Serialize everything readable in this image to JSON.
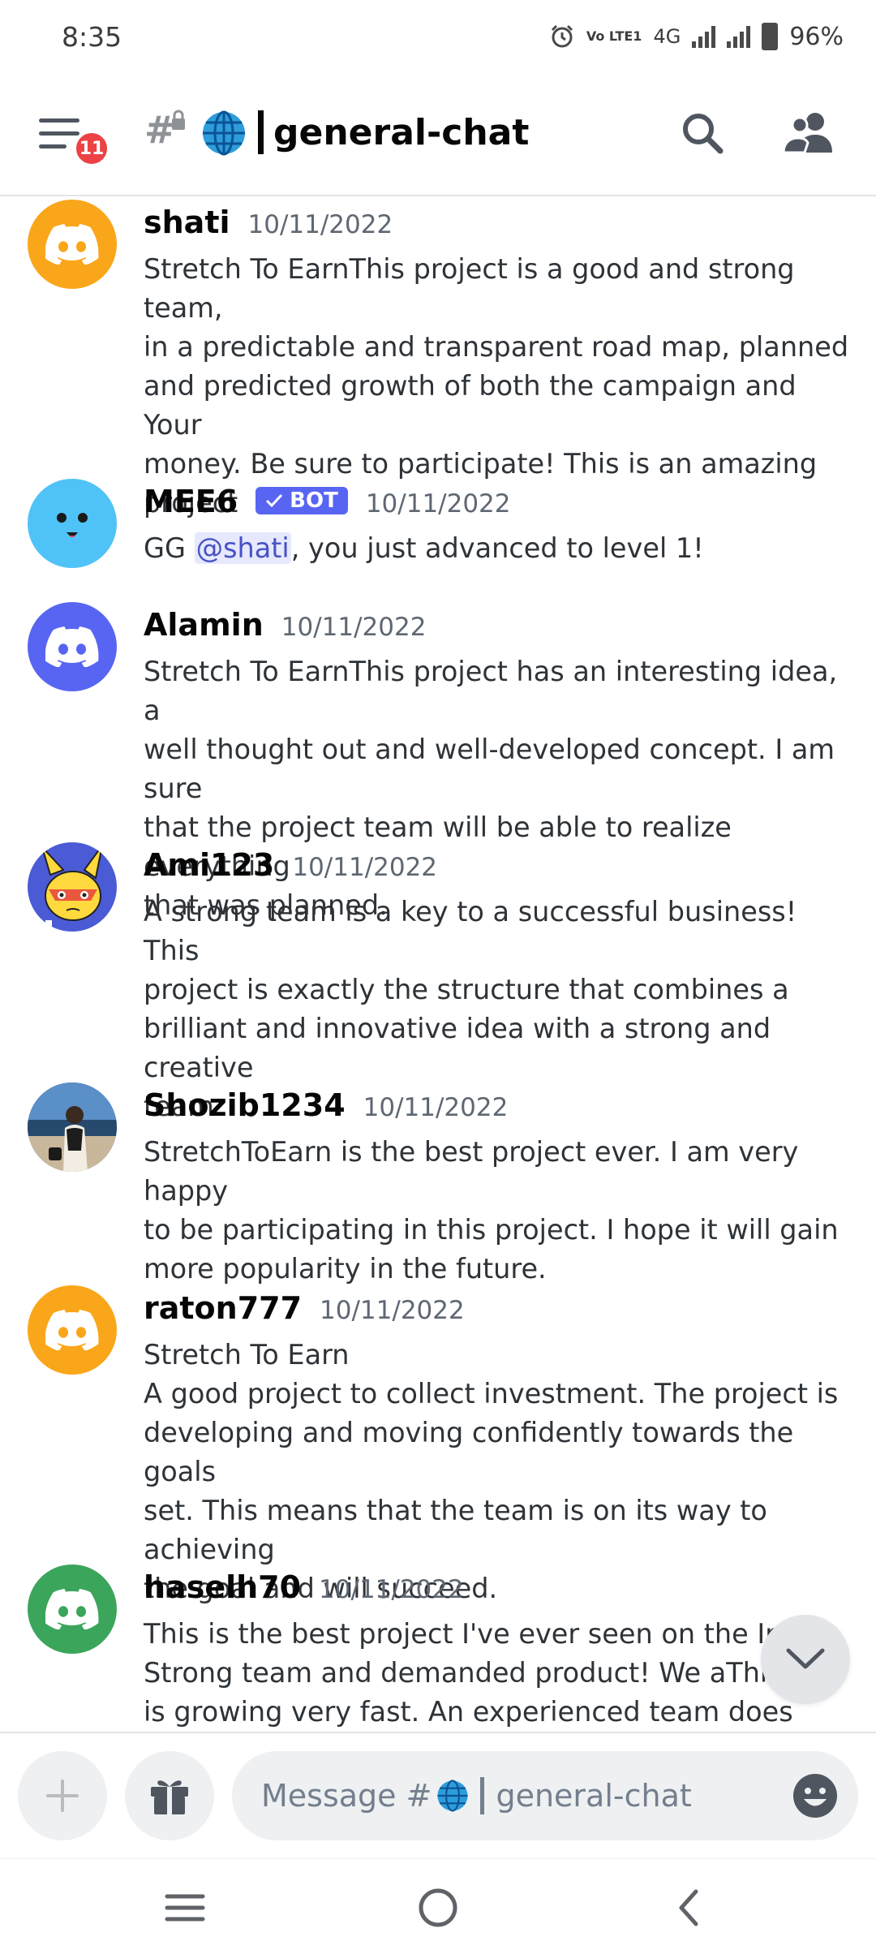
{
  "status_bar": {
    "time": "8:35",
    "network": "4G",
    "volte": "Vo LTE1",
    "battery": "96%"
  },
  "header": {
    "notification_count": "11",
    "channel_name": "general-chat",
    "channel_emoji": "🌐"
  },
  "messages": [
    {
      "author": "shati",
      "time": "10/11/2022",
      "avatar": "discord-logo",
      "avatar_color": "#faa61a",
      "lines": [
        "Stretch To EarnThis project is a good and strong team,",
        "in a predictable and transparent road map, planned",
        "and predicted growth of both the campaign and Your",
        "money. Be sure to participate! This is an amazing",
        "project"
      ]
    },
    {
      "author": "MEE6",
      "time": "10/11/2022",
      "avatar": "mee6-face",
      "avatar_color": "#4fc3f7",
      "bot_label": "BOT",
      "text_before": "GG ",
      "mention": "@shati",
      "text_after": ", you just advanced to level 1!"
    },
    {
      "author": "Alamin",
      "time": "10/11/2022",
      "avatar": "discord-logo",
      "avatar_color": "#5865f2",
      "lines": [
        "Stretch To EarnThis project has an interesting idea, a",
        "well thought out and well-developed concept. I am sure",
        "that the project team will be able to realize everything",
        "that was planned."
      ]
    },
    {
      "author": "Ami123",
      "time": "10/11/2022",
      "avatar": "cartoon-bunny",
      "avatar_color": "#4b5bd6",
      "lines": [
        "A strong team is a key to a successful business! This",
        "project is exactly the structure that combines a",
        "brilliant and innovative idea with a strong and creative",
        "team"
      ]
    },
    {
      "author": "Shozib1234",
      "time": "10/11/2022",
      "avatar": "photo",
      "avatar_color": "#3d6c9e",
      "lines": [
        "StretchToEarn is the best project ever. I am very happy",
        "to be participating in this project. I hope it will gain",
        "more popularity in the future."
      ]
    },
    {
      "author": "raton777",
      "time": "10/11/2022",
      "avatar": "discord-logo",
      "avatar_color": "#faa61a",
      "lines": [
        "Stretch To Earn",
        "A good project to collect investment. The project is",
        "developing and moving confidently towards the goals",
        "set. This means that the team is on its way to achieving",
        "the goal and will succeed."
      ]
    },
    {
      "author": "haselh70",
      "time": "10/11/2022",
      "avatar": "discord-logo",
      "avatar_color": "#3ba55c",
      "lines": [
        "This is the best project I've ever seen on the Inter",
        "Strong team and demanded product! We aThis p",
        "is growing very fast. An experienced team does"
      ]
    }
  ],
  "input": {
    "placeholder_prefix": "Message #",
    "channel_emoji": "🌐",
    "channel_name": "general-chat"
  },
  "icons": {
    "menu": "menu-icon",
    "search": "search-icon",
    "members": "members-icon",
    "add": "plus-icon",
    "gift": "gift-icon",
    "emoji": "emoji-icon",
    "scroll": "chevron-down-icon"
  }
}
